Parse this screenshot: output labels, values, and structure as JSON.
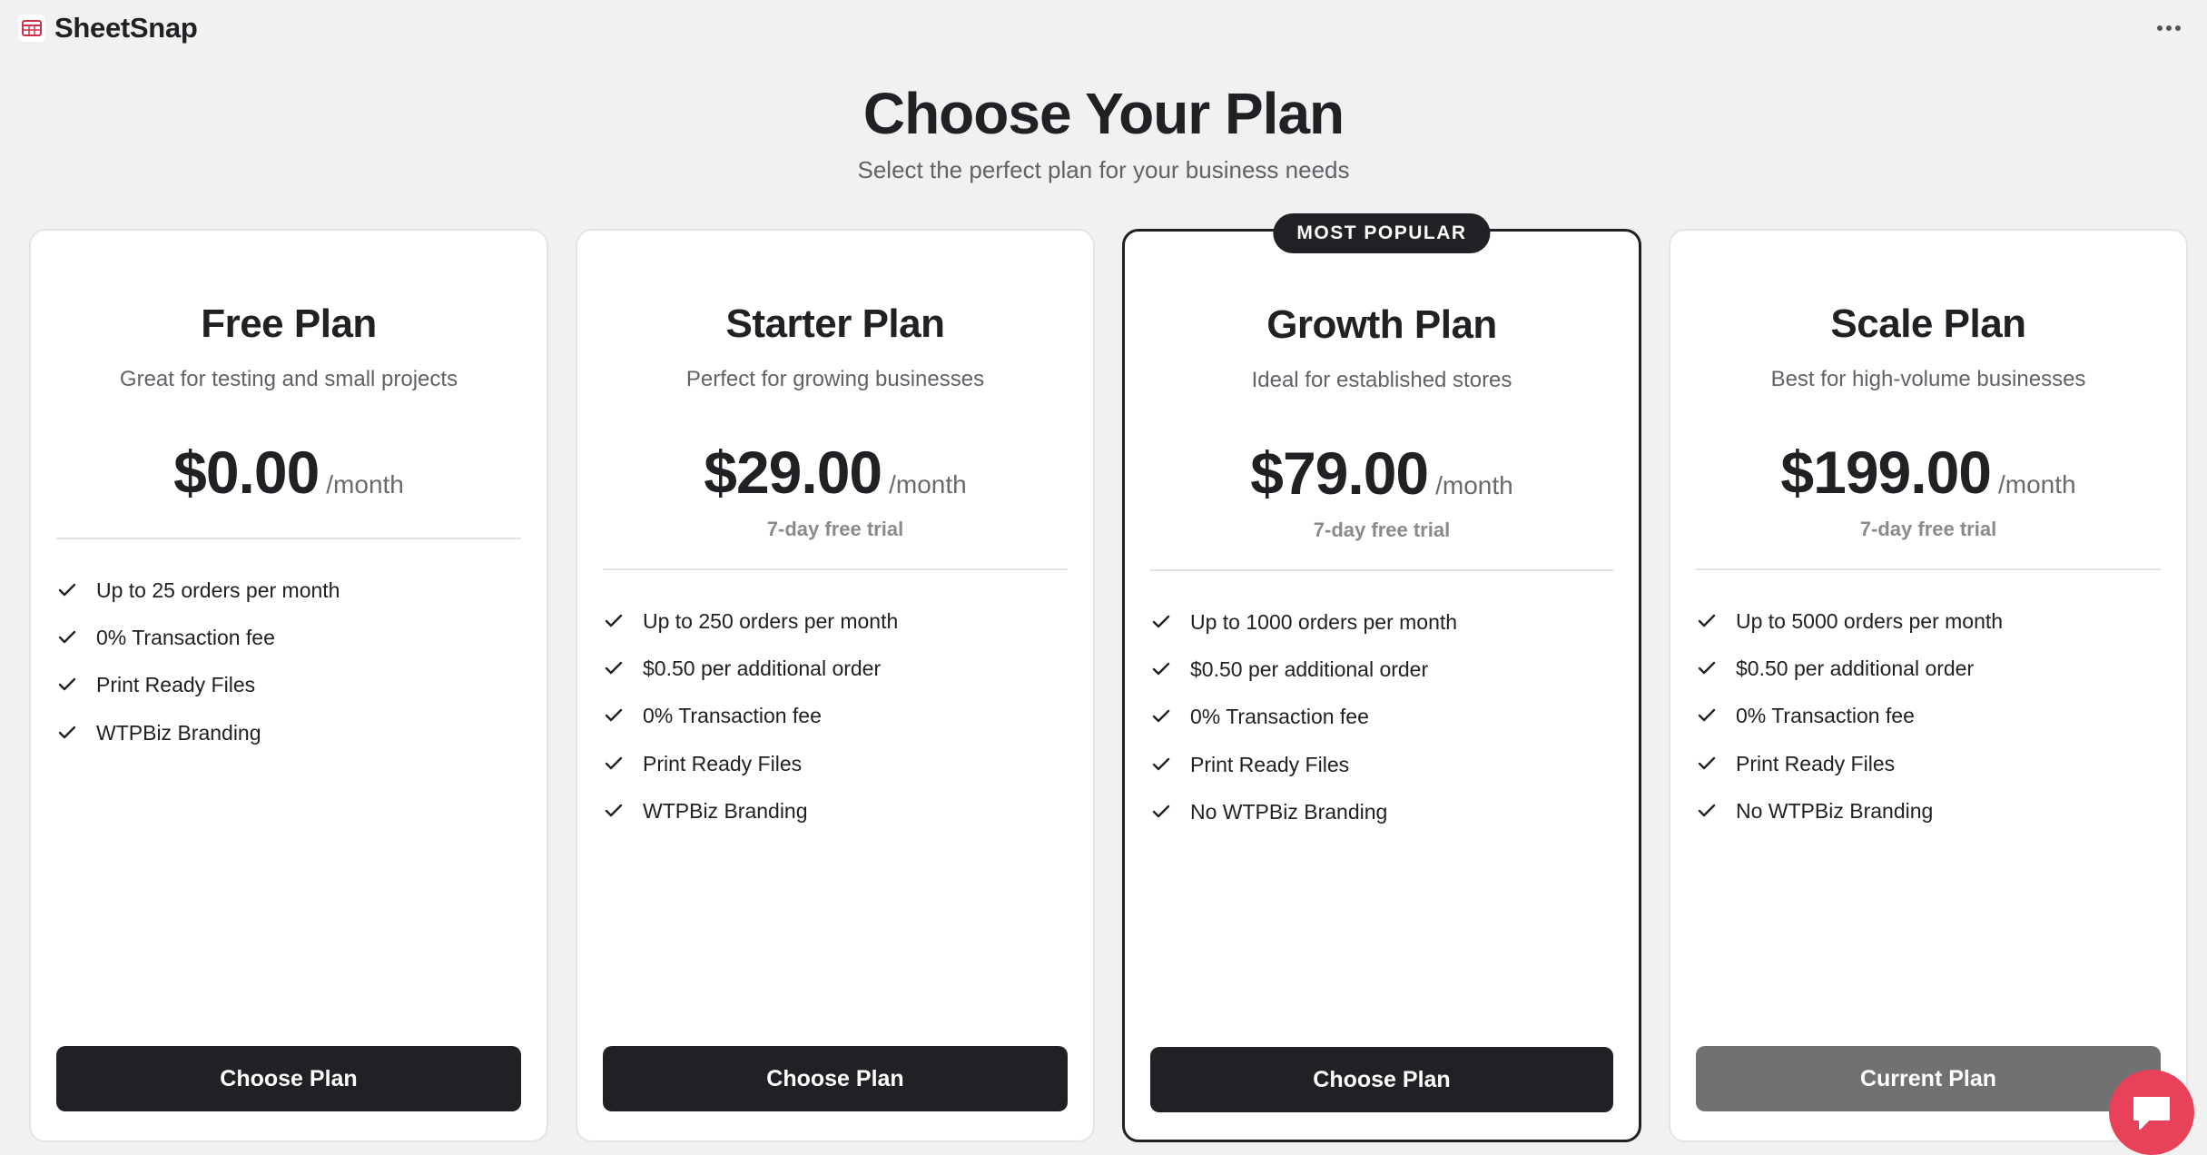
{
  "app": {
    "name": "SheetSnap",
    "icon": "spreadsheet-icon"
  },
  "header": {
    "title": "Choose Your Plan",
    "subtitle": "Select the perfect plan for your business needs"
  },
  "plans": [
    {
      "name": "Free Plan",
      "description": "Great for testing and small projects",
      "price": "$0.00",
      "period": "/month",
      "trial": "",
      "features": [
        "Up to 25 orders per month",
        "0% Transaction fee",
        "Print Ready Files",
        "WTPBiz Branding"
      ],
      "button": "Choose Plan"
    },
    {
      "name": "Starter Plan",
      "description": "Perfect for growing businesses",
      "price": "$29.00",
      "period": "/month",
      "trial": "7-day free trial",
      "features": [
        "Up to 250 orders per month",
        "$0.50 per additional order",
        "0% Transaction fee",
        "Print Ready Files",
        "WTPBiz Branding"
      ],
      "button": "Choose Plan"
    },
    {
      "name": "Growth Plan",
      "badge": "MOST POPULAR",
      "description": "Ideal for established stores",
      "price": "$79.00",
      "period": "/month",
      "trial": "7-day free trial",
      "features": [
        "Up to 1000 orders per month",
        "$0.50 per additional order",
        "0% Transaction fee",
        "Print Ready Files",
        "No WTPBiz Branding"
      ],
      "button": "Choose Plan"
    },
    {
      "name": "Scale Plan",
      "description": "Best for high-volume businesses",
      "price": "$199.00",
      "period": "/month",
      "trial": "7-day free trial",
      "features": [
        "Up to 5000 orders per month",
        "$0.50 per additional order",
        "0% Transaction fee",
        "Print Ready Files",
        "No WTPBiz Branding"
      ],
      "button": "Current Plan"
    }
  ],
  "colors": {
    "background": "#f1f1f1",
    "dark": "#202124",
    "current_plan_button": "#6f7173",
    "chat_button": "#e8425a"
  },
  "icons": {
    "check": "check-icon",
    "more": "more-icon",
    "chat": "chat-icon"
  }
}
